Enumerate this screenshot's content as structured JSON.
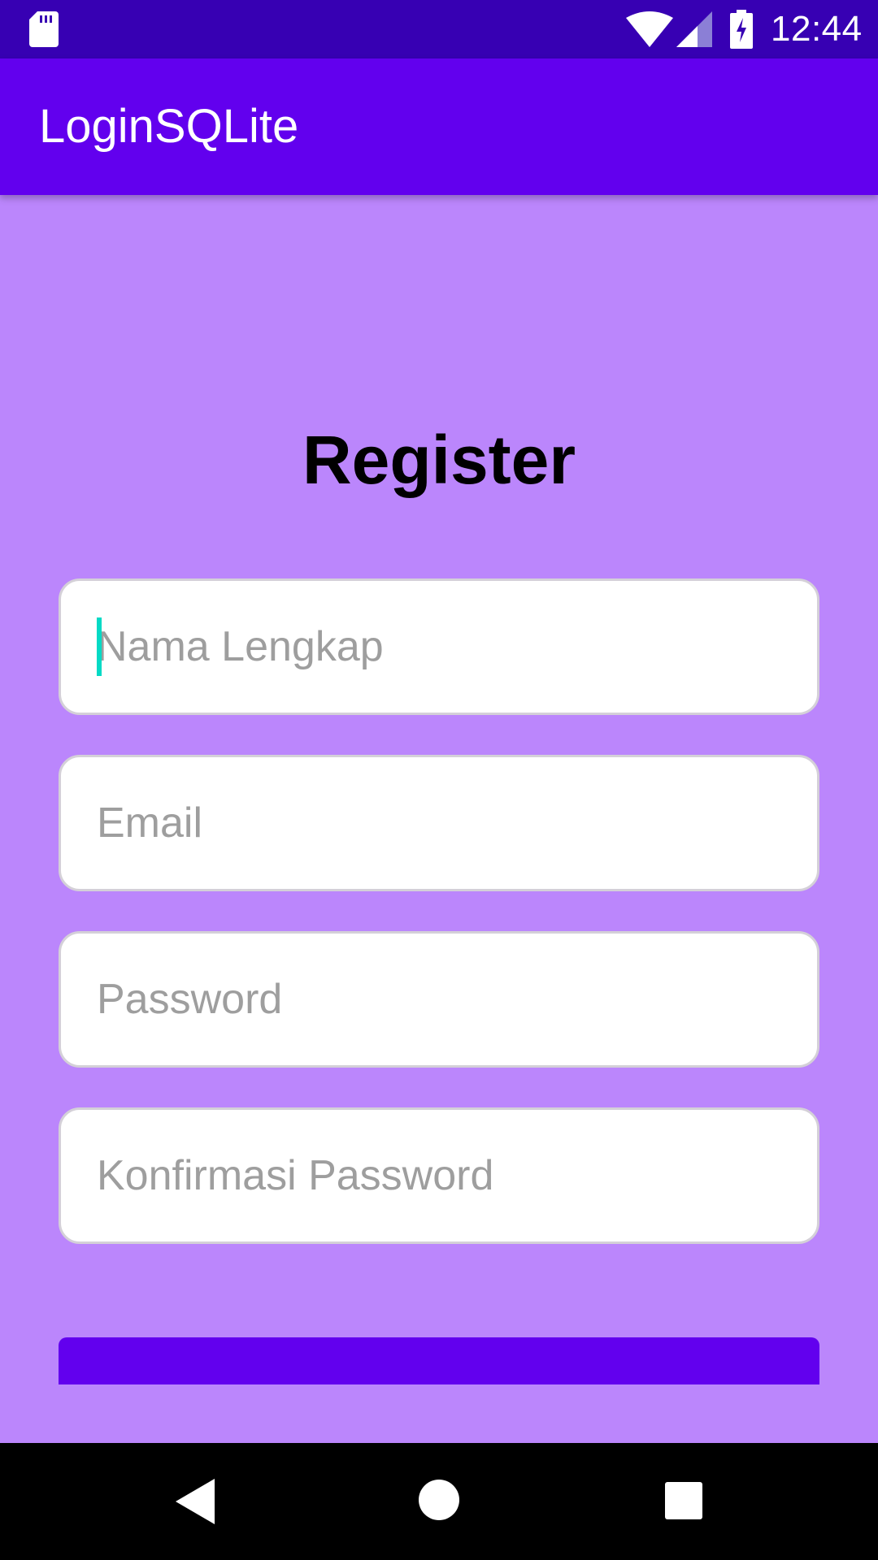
{
  "status_bar": {
    "time": "12:44",
    "icons": [
      "sd-card-icon",
      "wifi-icon",
      "signal-icon",
      "battery-charging-icon"
    ]
  },
  "app_bar": {
    "title": "LoginSQLite"
  },
  "form": {
    "heading": "Register",
    "fields": {
      "full_name": {
        "placeholder": "Nama Lengkap",
        "value": ""
      },
      "email": {
        "placeholder": "Email",
        "value": ""
      },
      "password": {
        "placeholder": "Password",
        "value": ""
      },
      "confirm_password": {
        "placeholder": "Konfirmasi Password",
        "value": ""
      }
    }
  },
  "nav_bar": {
    "icons": [
      "back-icon",
      "home-icon",
      "recents-icon"
    ]
  },
  "colors": {
    "status_bar": "#3700b3",
    "app_bar": "#6200ee",
    "background": "#bb86fc",
    "button": "#6200ee",
    "cursor": "#03dac5"
  }
}
